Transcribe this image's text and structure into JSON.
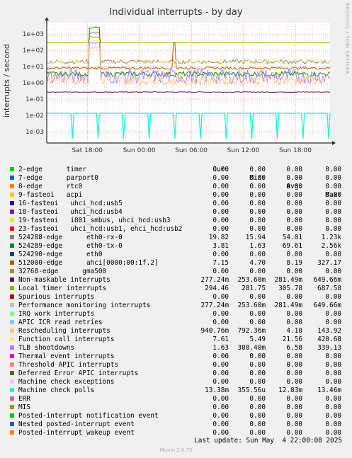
{
  "chart_data": {
    "type": "line",
    "title": "Individual interrupts - by day",
    "ylabel": "interrupts / second",
    "yscale": "log",
    "ylim": [
      0.0002,
      5000
    ],
    "yticks": [
      "1e+03",
      "1e+02",
      "1e+01",
      "1e+00",
      "1e-01",
      "1e-02",
      "1e-03"
    ],
    "xticks": [
      "Sat 18:00",
      "Sun 00:00",
      "Sun 06:00",
      "Sun 12:00",
      "Sun 18:00"
    ],
    "xrange_hours": [
      "Sat 13:20",
      "Sun 22:00"
    ],
    "grid": true,
    "columns": [
      "Cur:",
      "Min:",
      "Avg:",
      "Max:"
    ],
    "series": [
      {
        "name": "2-edge      timer",
        "color": "#00cc00",
        "cur": "0.00",
        "min": "0.00",
        "avg": "0.00",
        "max": "0.00"
      },
      {
        "name": "7-edge      parport0",
        "color": "#0066b3",
        "cur": "0.00",
        "min": "0.00",
        "avg": "0.00",
        "max": "0.00"
      },
      {
        "name": "8-edge      rtc0",
        "color": "#ff8000",
        "cur": "0.00",
        "min": "0.00",
        "avg": "0.00",
        "max": "0.00"
      },
      {
        "name": "9-fasteoi   acpi",
        "color": "#ffcc00",
        "cur": "0.00",
        "min": "0.00",
        "avg": "0.00",
        "max": "0.00"
      },
      {
        "name": "16-fasteoi   uhci_hcd:usb5",
        "color": "#330099",
        "cur": "0.00",
        "min": "0.00",
        "avg": "0.00",
        "max": "0.00"
      },
      {
        "name": "18-fasteoi   uhci_hcd:usb4",
        "color": "#990099",
        "cur": "0.00",
        "min": "0.00",
        "avg": "0.00",
        "max": "0.00"
      },
      {
        "name": "19-fasteoi   i801_smbus, uhci_hcd:usb3",
        "color": "#ccff00",
        "cur": "0.00",
        "min": "0.00",
        "avg": "0.00",
        "max": "0.00"
      },
      {
        "name": "23-fasteoi   uhci_hcd:usb1, ehci_hcd:usb2",
        "color": "#ff0000",
        "cur": "0.00",
        "min": "0.00",
        "avg": "0.00",
        "max": "0.00"
      },
      {
        "name": "524288-edge      eth0-rx-0",
        "color": "#808080",
        "cur": "19.82",
        "min": "15.94",
        "avg": "54.01",
        "max": "1.23k"
      },
      {
        "name": "524289-edge      eth0-tx-0",
        "color": "#008f00",
        "cur": "3.81",
        "min": "1.63",
        "avg": "69.61",
        "max": "2.56k"
      },
      {
        "name": "524290-edge      eth0",
        "color": "#00487d",
        "cur": "0.00",
        "min": "0.00",
        "avg": "0.00",
        "max": "0.00"
      },
      {
        "name": "512000-edge      ahci[0000:00:1f.2]",
        "color": "#b35a00",
        "cur": "7.15",
        "min": "4.70",
        "avg": "8.19",
        "max": "327.17"
      },
      {
        "name": "32768-edge      gma500",
        "color": "#b38f00",
        "cur": "0.00",
        "min": "0.00",
        "avg": "0.00",
        "max": "0.00"
      },
      {
        "name": "Non-maskable interrupts",
        "color": "#6b006b",
        "cur": "277.24m",
        "min": "253.60m",
        "avg": "281.49m",
        "max": "649.66m"
      },
      {
        "name": "Local timer interrupts",
        "color": "#8fb300",
        "cur": "294.46",
        "min": "281.75",
        "avg": "305.78",
        "max": "687.58"
      },
      {
        "name": "Spurious interrupts",
        "color": "#b30000",
        "cur": "0.00",
        "min": "0.00",
        "avg": "0.00",
        "max": "0.00"
      },
      {
        "name": "Performance monitoring interrupts",
        "color": "#bebebe",
        "cur": "277.24m",
        "min": "253.60m",
        "avg": "281.49m",
        "max": "649.66m"
      },
      {
        "name": "IRQ work interrupts",
        "color": "#80ff80",
        "cur": "0.00",
        "min": "0.00",
        "avg": "0.00",
        "max": "0.00"
      },
      {
        "name": "APIC ICR read retries",
        "color": "#80c9ff",
        "cur": "0.00",
        "min": "0.00",
        "avg": "0.00",
        "max": "0.00"
      },
      {
        "name": "Rescheduling interrupts",
        "color": "#ffc080",
        "cur": "940.76m",
        "min": "792.36m",
        "avg": "4.10",
        "max": "143.92"
      },
      {
        "name": "Function call interrupts",
        "color": "#ffe680",
        "cur": "7.61",
        "min": "5.49",
        "avg": "21.56",
        "max": "420.68"
      },
      {
        "name": "TLB shootdowns",
        "color": "#aa80ff",
        "cur": "1.63",
        "min": "308.40m",
        "avg": "6.58",
        "max": "339.13"
      },
      {
        "name": "Thermal event interrupts",
        "color": "#ee00cc",
        "cur": "0.00",
        "min": "0.00",
        "avg": "0.00",
        "max": "0.00"
      },
      {
        "name": "Threshold APIC interrupts",
        "color": "#ff8080",
        "cur": "0.00",
        "min": "0.00",
        "avg": "0.00",
        "max": "0.00"
      },
      {
        "name": "Deferred Error APIC interrupts",
        "color": "#666600",
        "cur": "0.00",
        "min": "0.00",
        "avg": "0.00",
        "max": "0.00"
      },
      {
        "name": "Machine check exceptions",
        "color": "#ffbfff",
        "cur": "0.00",
        "min": "0.00",
        "avg": "0.00",
        "max": "0.00"
      },
      {
        "name": "Machine check polls",
        "color": "#00ffcc",
        "cur": "13.38m",
        "min": "355.56u",
        "avg": "12.83m",
        "max": "13.46m"
      },
      {
        "name": "ERR",
        "color": "#cc6699",
        "cur": "0.00",
        "min": "0.00",
        "avg": "0.00",
        "max": "0.00"
      },
      {
        "name": "MIS",
        "color": "#999900",
        "cur": "0.00",
        "min": "0.00",
        "avg": "0.00",
        "max": "0.00"
      },
      {
        "name": "Posted-interrupt notification event",
        "color": "#00cc00",
        "cur": "0.00",
        "min": "0.00",
        "avg": "0.00",
        "max": "0.00"
      },
      {
        "name": "Nested posted-interrupt event",
        "color": "#0066b3",
        "cur": "0.00",
        "min": "0.00",
        "avg": "0.00",
        "max": "0.00"
      },
      {
        "name": "Posted-interrupt wakeup event",
        "color": "#ff8000",
        "cur": "0.00",
        "min": "0.00",
        "avg": "0.00",
        "max": "0.00"
      }
    ]
  },
  "side_label": "RRDTOOL / TOBI OETIKER",
  "footer": "Last update: Sun May  4 22:00:08 2025",
  "munin": "Munin 2.0.73"
}
